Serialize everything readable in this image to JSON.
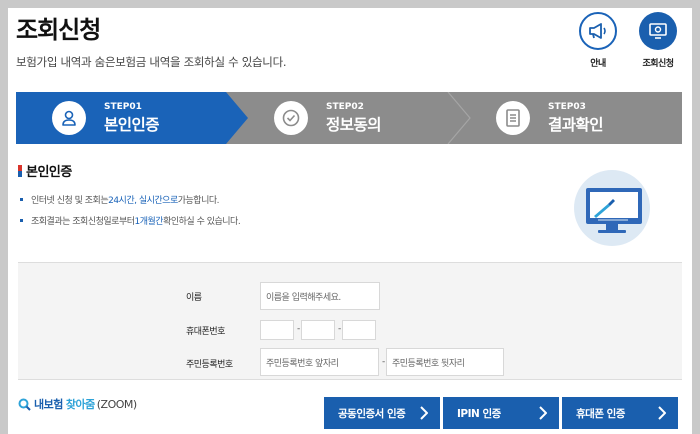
{
  "header": {
    "title": "조회신청",
    "description": "보험가입 내역과 숨은보험금 내역을 조회하실 수 있습니다."
  },
  "top_buttons": {
    "guide": {
      "label": "안내",
      "icon": "megaphone-icon"
    },
    "inquiry": {
      "label": "조회신청",
      "icon": "monitor-icon"
    }
  },
  "steps": [
    {
      "code": "STEP01",
      "name": "본인인증",
      "icon": "person-icon",
      "active": true
    },
    {
      "code": "STEP02",
      "name": "정보동의",
      "icon": "check-icon",
      "active": false
    },
    {
      "code": "STEP03",
      "name": "결과확인",
      "icon": "document-icon",
      "active": false
    }
  ],
  "section": {
    "title": "본인인증",
    "notes": {
      "n1": {
        "pre": "인터넷 신청 및 조회는 ",
        "em": "24시간, 실시간으로",
        "post": " 가능합니다."
      },
      "n2": {
        "pre": "조회결과는 조회신청일로부터 ",
        "em": "1개월간",
        "post": " 확인하실 수 있습니다."
      }
    }
  },
  "form": {
    "name": {
      "label": "이름",
      "placeholder": "이름을 입력해주세요."
    },
    "phone": {
      "label": "휴대폰번호",
      "separator": "-"
    },
    "rrn": {
      "label": "주민등록번호",
      "front_placeholder": "주민등록번호 앞자리",
      "back_placeholder": "주민등록번호 뒷자리",
      "separator": "-"
    }
  },
  "zoom": {
    "part1": "내보험",
    "part2": "찾아줌",
    "part3": "(ZOOM)"
  },
  "actions": {
    "cert": "공동인증서 인증",
    "ipin": "IPIN 인증",
    "phone": "휴대폰 인증"
  },
  "colors": {
    "primary": "#1a5fae",
    "accent": "#2ea3d8",
    "step_inactive": "#8c8c8c",
    "background": "#c9c9c9"
  }
}
